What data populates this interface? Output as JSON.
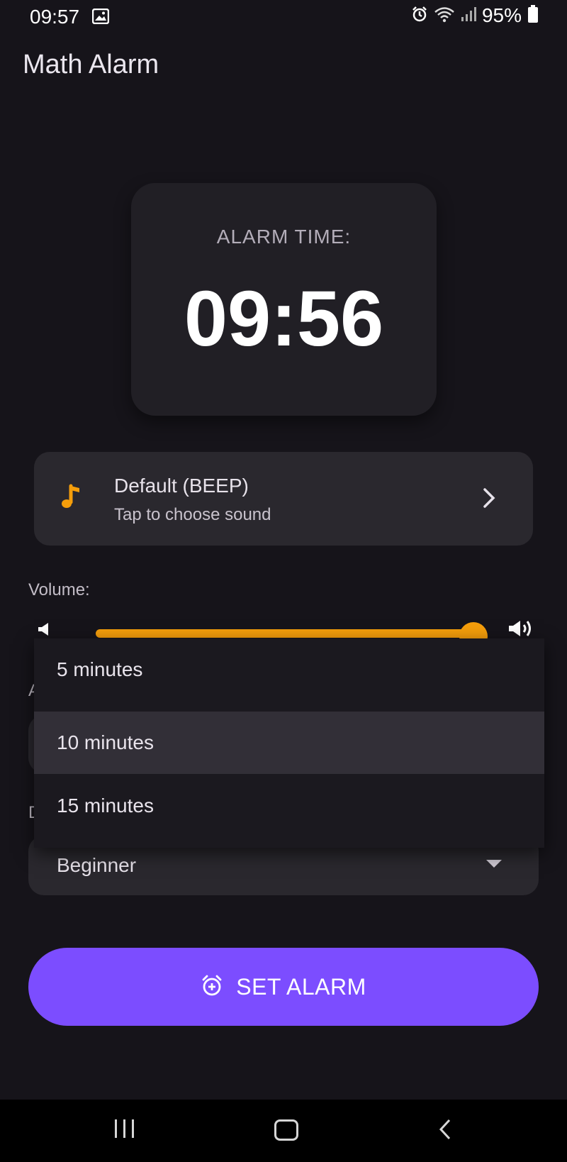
{
  "status_bar": {
    "time": "09:57",
    "battery": "95%",
    "icons": [
      "gallery-icon",
      "alarm-icon",
      "wifi-icon",
      "signal-icon",
      "battery-icon"
    ]
  },
  "app_bar": {
    "title": "Math Alarm"
  },
  "alarm_card": {
    "label": "ALARM TIME:",
    "time": "09:56"
  },
  "sound": {
    "icon": "music-note-icon",
    "title": "Default (BEEP)",
    "subtitle": "Tap to choose sound"
  },
  "volume": {
    "label": "Volume:",
    "level": 0.97
  },
  "hidden_labels": {
    "snooze_initial": "A",
    "difficulty_initial": "D"
  },
  "snooze_menu": {
    "options": [
      "5 minutes",
      "10 minutes",
      "15 minutes"
    ],
    "selected_index": 1
  },
  "difficulty": {
    "value": "Beginner"
  },
  "set_alarm_button": {
    "label": "SET ALARM",
    "icon": "alarm-add-icon"
  },
  "colors": {
    "background": "#16141a",
    "accent_orange": "#f59e0b",
    "primary_purple": "#7c4dff",
    "card": "#2a282e"
  }
}
